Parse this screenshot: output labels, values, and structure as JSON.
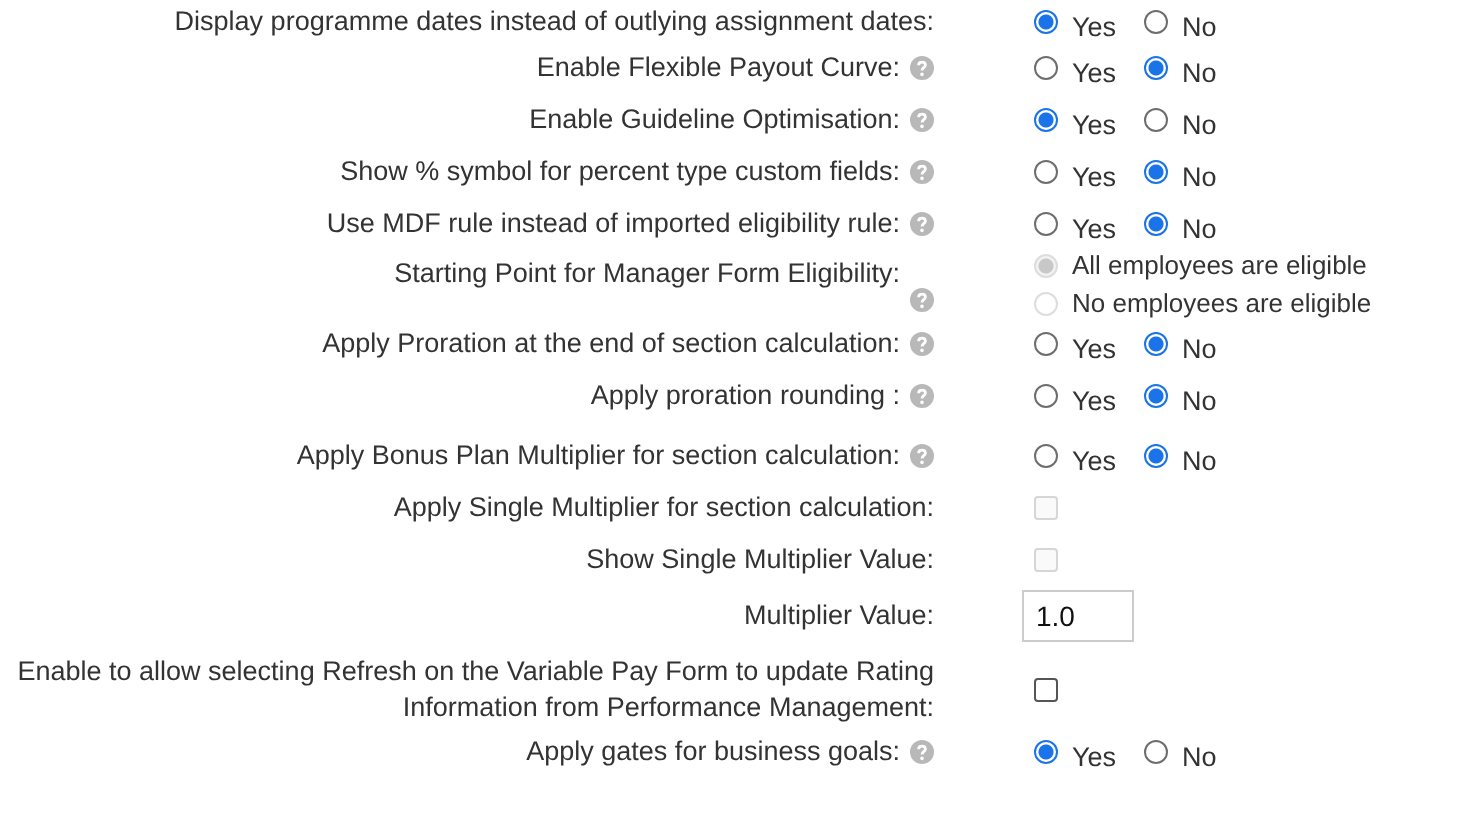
{
  "settings": [
    {
      "label": "Display programme dates instead of outlying assignment dates:",
      "help": false,
      "kind": "radio",
      "options": [
        {
          "label": "Yes",
          "selected": true,
          "disabled": false
        },
        {
          "label": "No",
          "selected": false,
          "disabled": false
        }
      ]
    },
    {
      "label": "Enable Flexible Payout Curve:",
      "help": true,
      "kind": "radio",
      "options": [
        {
          "label": "Yes",
          "selected": false,
          "disabled": false
        },
        {
          "label": "No",
          "selected": true,
          "disabled": false
        }
      ]
    },
    {
      "label": "Enable Guideline Optimisation:",
      "help": true,
      "kind": "radio",
      "options": [
        {
          "label": "Yes",
          "selected": true,
          "disabled": false
        },
        {
          "label": "No",
          "selected": false,
          "disabled": false
        }
      ]
    },
    {
      "label": "Show % symbol for percent type custom fields:",
      "help": true,
      "kind": "radio",
      "options": [
        {
          "label": "Yes",
          "selected": false,
          "disabled": false
        },
        {
          "label": "No",
          "selected": true,
          "disabled": false
        }
      ]
    },
    {
      "label": "Use MDF rule instead of imported eligibility rule:",
      "help": true,
      "kind": "radio",
      "options": [
        {
          "label": "Yes",
          "selected": false,
          "disabled": false
        },
        {
          "label": "No",
          "selected": true,
          "disabled": false
        }
      ]
    },
    {
      "label": "Starting Point for Manager Form Eligibility:",
      "help": true,
      "kind": "radio-list",
      "options": [
        {
          "label": "All employees are eligible",
          "selected": true,
          "disabled": true
        },
        {
          "label": "No employees are eligible",
          "selected": false,
          "disabled": true
        }
      ]
    },
    {
      "label": "Apply Proration at the end of section calculation:",
      "help": true,
      "kind": "radio",
      "options": [
        {
          "label": "Yes",
          "selected": false,
          "disabled": false
        },
        {
          "label": "No",
          "selected": true,
          "disabled": false
        }
      ]
    },
    {
      "label": "Apply proration rounding :",
      "help": true,
      "kind": "radio",
      "options": [
        {
          "label": "Yes",
          "selected": false,
          "disabled": false
        },
        {
          "label": "No",
          "selected": true,
          "disabled": false
        }
      ]
    },
    {
      "label": "Apply Bonus Plan Multiplier for section calculation:",
      "help": true,
      "kind": "radio",
      "options": [
        {
          "label": "Yes",
          "selected": false,
          "disabled": false
        },
        {
          "label": "No",
          "selected": true,
          "disabled": false
        }
      ]
    },
    {
      "label": "Apply Single Multiplier for section calculation:",
      "help": false,
      "kind": "checkbox",
      "checked": false,
      "disabled": true
    },
    {
      "label": "Show Single Multiplier Value:",
      "help": false,
      "kind": "checkbox",
      "checked": false,
      "disabled": true
    },
    {
      "label": "Multiplier Value:",
      "help": false,
      "kind": "input",
      "value": "1.0"
    },
    {
      "label": "Enable to allow selecting Refresh on the Variable Pay Form to update Rating Information from Performance Management:",
      "help": false,
      "kind": "checkbox",
      "checked": false,
      "disabled": false
    },
    {
      "label": "Apply gates for business goals:",
      "help": true,
      "kind": "radio",
      "options": [
        {
          "label": "Yes",
          "selected": true,
          "disabled": false
        },
        {
          "label": "No",
          "selected": false,
          "disabled": false
        }
      ]
    }
  ]
}
